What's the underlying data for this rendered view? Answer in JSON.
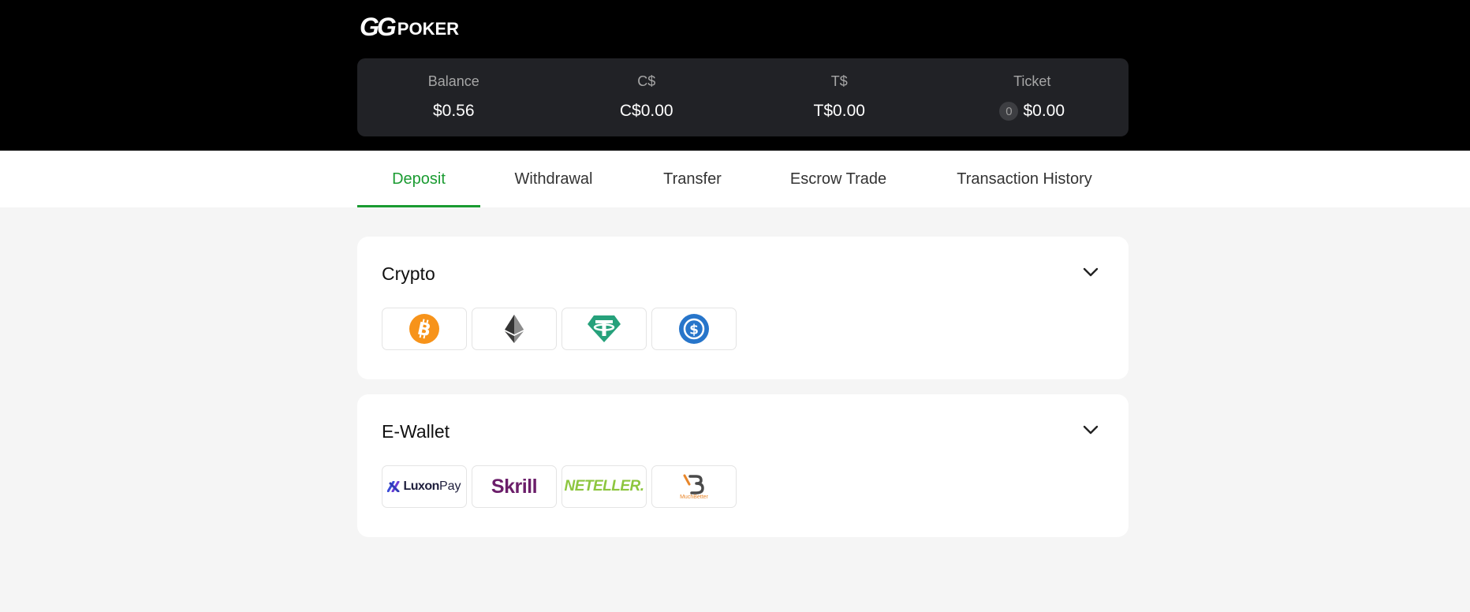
{
  "header": {
    "logo_gg": "GG",
    "logo_word": "POKER"
  },
  "balances": [
    {
      "label": "Balance",
      "value": "$0.56"
    },
    {
      "label": "C$",
      "value": "C$0.00"
    },
    {
      "label": "T$",
      "value": "T$0.00"
    },
    {
      "label": "Ticket",
      "value": "$0.00",
      "count": "0"
    }
  ],
  "tabs": [
    {
      "label": "Deposit",
      "active": true
    },
    {
      "label": "Withdrawal",
      "active": false
    },
    {
      "label": "Transfer",
      "active": false
    },
    {
      "label": "Escrow Trade",
      "active": false
    },
    {
      "label": "Transaction History",
      "active": false
    }
  ],
  "sections": {
    "crypto": {
      "title": "Crypto",
      "methods": [
        "bitcoin-icon",
        "ethereum-icon",
        "tether-icon",
        "usd-coin-icon"
      ]
    },
    "ewallet": {
      "title": "E-Wallet",
      "methods": [
        {
          "name": "luxonpay-logo",
          "text": "LuxonPay",
          "text_a": "Luxon",
          "text_b": "Pay"
        },
        {
          "name": "skrill-logo",
          "text": "Skrill"
        },
        {
          "name": "neteller-logo",
          "text": "NETELLER."
        },
        {
          "name": "muchbetter-logo",
          "text": "MuchBetter"
        }
      ]
    }
  },
  "colors": {
    "accent": "#1a9b31",
    "bitcoin": "#f7931a",
    "tether": "#26a17b",
    "usdc": "#2775ca",
    "skrill": "#6b1e6a",
    "neteller": "#8dc63f",
    "muchbetter": "#e8862a"
  }
}
